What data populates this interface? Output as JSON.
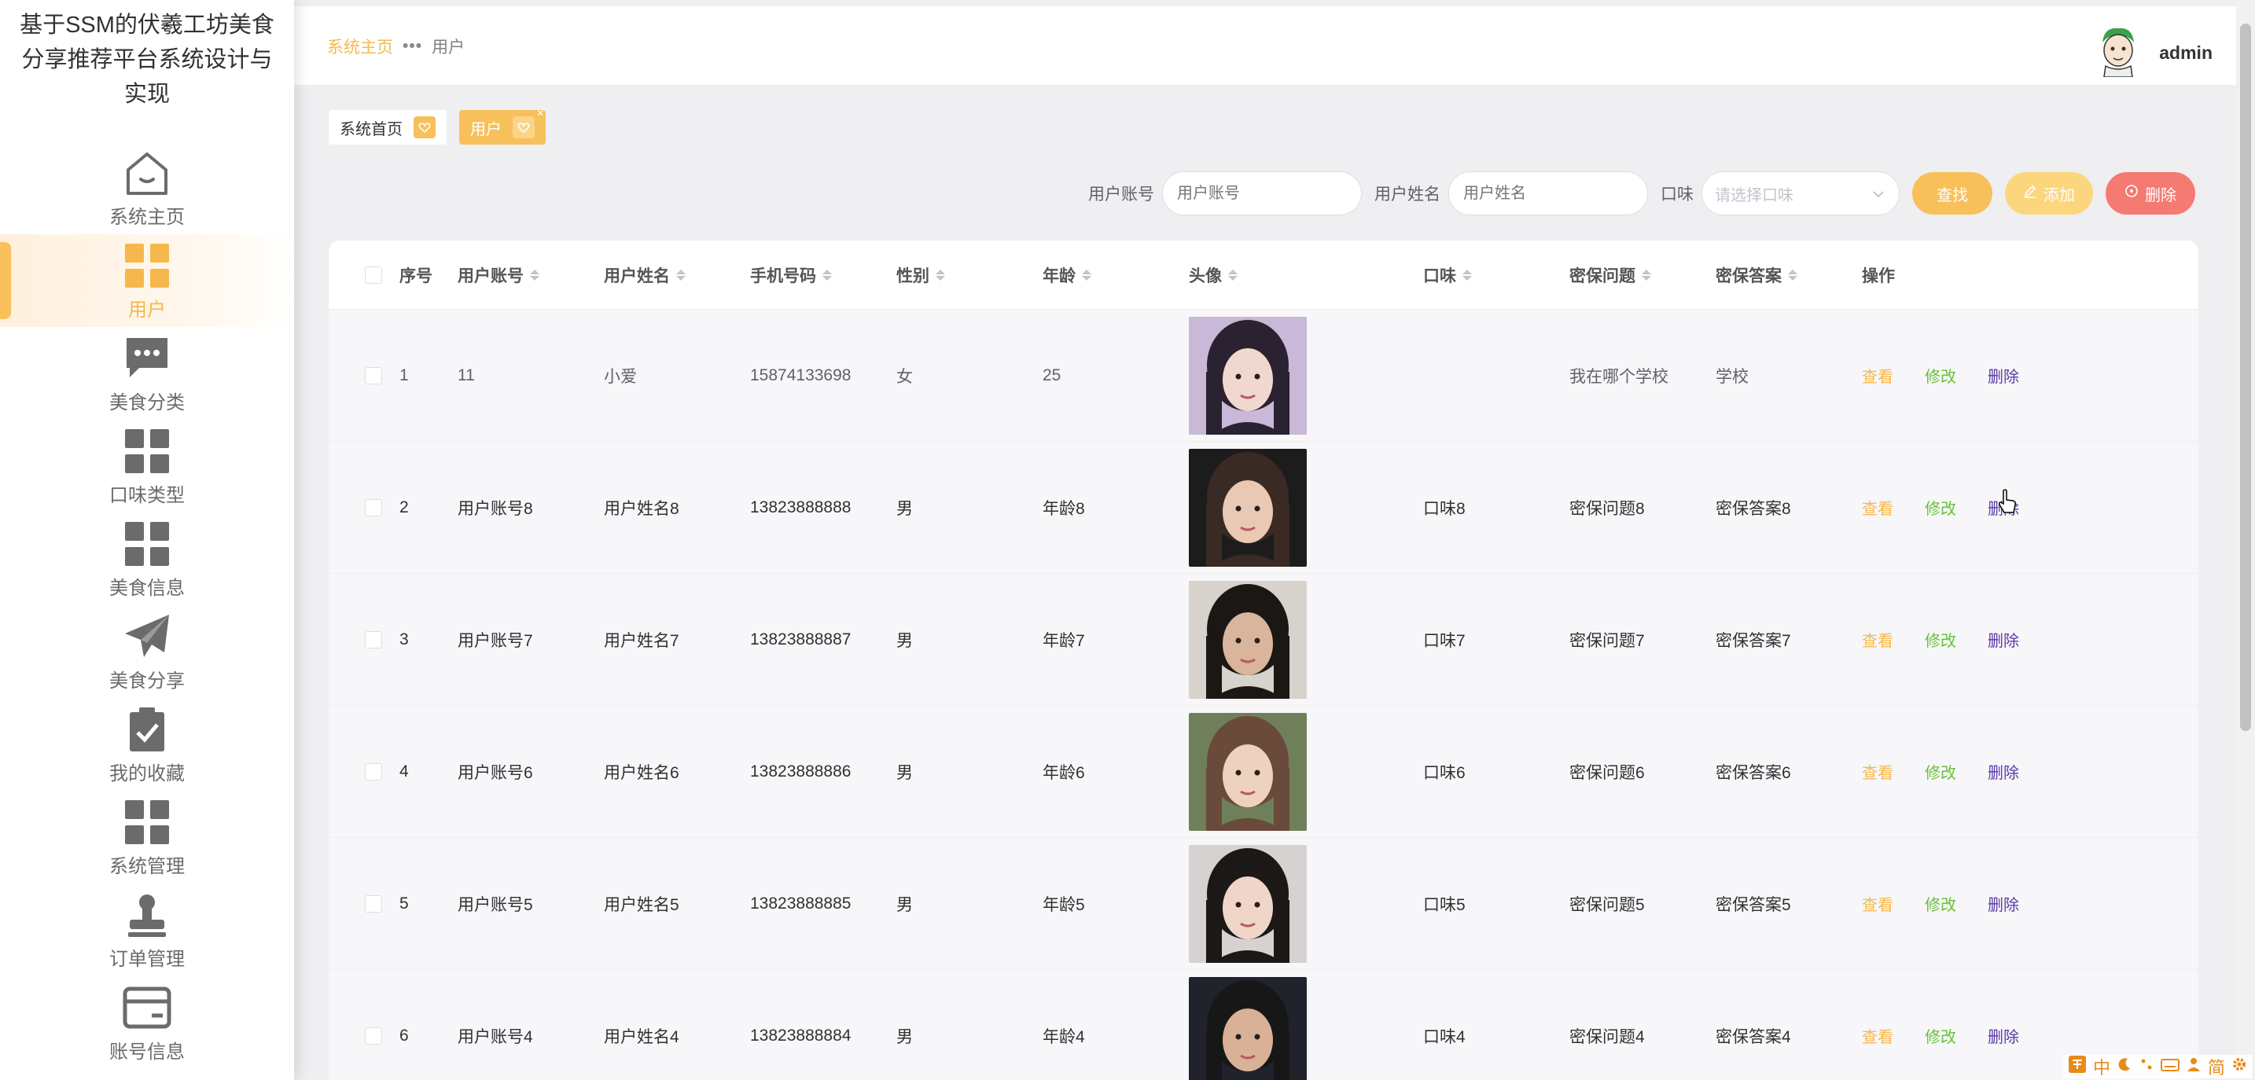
{
  "app": {
    "title": "基于SSM的伏羲工坊美食分享推荐平台系统设计与实现"
  },
  "sidebar": {
    "items": [
      {
        "label": "系统主页",
        "icon": "home-icon",
        "active": false
      },
      {
        "label": "用户",
        "icon": "grid-icon",
        "active": true
      },
      {
        "label": "美食分类",
        "icon": "chat-bubble-icon",
        "active": false
      },
      {
        "label": "口味类型",
        "icon": "grid-icon",
        "active": false
      },
      {
        "label": "美食信息",
        "icon": "grid-icon",
        "active": false
      },
      {
        "label": "美食分享",
        "icon": "paper-plane-icon",
        "active": false
      },
      {
        "label": "我的收藏",
        "icon": "clipboard-check-icon",
        "active": false
      },
      {
        "label": "系统管理",
        "icon": "grid-icon",
        "active": false
      },
      {
        "label": "订单管理",
        "icon": "stamp-icon",
        "active": false
      },
      {
        "label": "账号信息",
        "icon": "card-icon",
        "active": false
      }
    ]
  },
  "topbar": {
    "breadcrumb_home": "系统主页",
    "breadcrumb_current": "用户",
    "username": "admin"
  },
  "tabs": [
    {
      "label": "系统首页",
      "active": false
    },
    {
      "label": "用户",
      "active": true
    }
  ],
  "search": {
    "account_label": "用户账号",
    "account_placeholder": "用户账号",
    "name_label": "用户姓名",
    "name_placeholder": "用户姓名",
    "taste_label": "口味",
    "taste_placeholder": "请选择口味",
    "find_label": "查找",
    "add_label": "添加",
    "delete_label": "删除"
  },
  "table": {
    "headers": {
      "idx": "序号",
      "account": "用户账号",
      "name": "用户姓名",
      "phone": "手机号码",
      "sex": "性别",
      "age": "年龄",
      "avatar": "头像",
      "taste": "口味",
      "question": "密保问题",
      "answer": "密保答案",
      "ops": "操作"
    },
    "ops": {
      "view": "查看",
      "edit": "修改",
      "delete": "删除"
    },
    "rows": [
      {
        "idx": "1",
        "account": "11",
        "name": "小爱",
        "phone": "15874133698",
        "sex": "女",
        "age": "25",
        "taste": "",
        "question": "我在哪个学校",
        "answer": "学校"
      },
      {
        "idx": "2",
        "account": "用户账号8",
        "name": "用户姓名8",
        "phone": "13823888888",
        "sex": "男",
        "age": "年龄8",
        "taste": "口味8",
        "question": "密保问题8",
        "answer": "密保答案8"
      },
      {
        "idx": "3",
        "account": "用户账号7",
        "name": "用户姓名7",
        "phone": "13823888887",
        "sex": "男",
        "age": "年龄7",
        "taste": "口味7",
        "question": "密保问题7",
        "answer": "密保答案7"
      },
      {
        "idx": "4",
        "account": "用户账号6",
        "name": "用户姓名6",
        "phone": "13823888886",
        "sex": "男",
        "age": "年龄6",
        "taste": "口味6",
        "question": "密保问题6",
        "answer": "密保答案6"
      },
      {
        "idx": "5",
        "account": "用户账号5",
        "name": "用户姓名5",
        "phone": "13823888885",
        "sex": "男",
        "age": "年龄5",
        "taste": "口味5",
        "question": "密保问题5",
        "answer": "密保答案5"
      },
      {
        "idx": "6",
        "account": "用户账号4",
        "name": "用户姓名4",
        "phone": "13823888884",
        "sex": "男",
        "age": "年龄4",
        "taste": "口味4",
        "question": "密保问题4",
        "answer": "密保答案4"
      }
    ]
  },
  "ime": {
    "items": [
      "中",
      "简"
    ]
  },
  "colors": {
    "accent": "#f8c05b",
    "danger": "#f47a72",
    "edit": "#67c23a",
    "delete_link": "#5a3aa8"
  }
}
